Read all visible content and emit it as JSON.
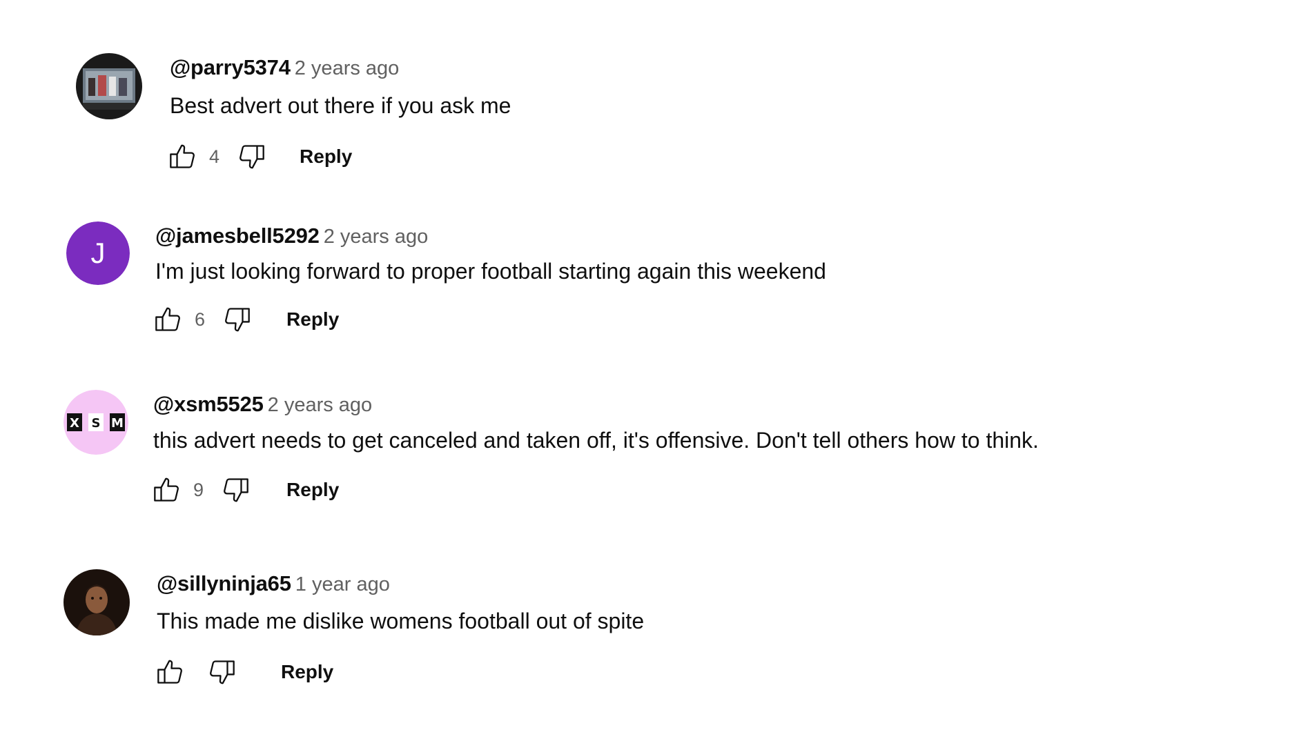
{
  "comments": [
    {
      "author": "@parry5374",
      "time": "2 years ago",
      "text": "Best advert out there if you ask me",
      "likes": "4",
      "reply_label": "Reply",
      "avatar": {
        "type": "photo",
        "description_icon": "shop-window-photo"
      }
    },
    {
      "author": "@jamesbell5292",
      "time": "2 years ago",
      "text": "I'm just looking forward to proper football starting again this weekend",
      "likes": "6",
      "reply_label": "Reply",
      "avatar": {
        "type": "letter",
        "letter": "J",
        "color": "#7b2cbf"
      }
    },
    {
      "author": "@xsm5525",
      "time": "2 years ago",
      "text": "this advert needs to get canceled and taken off, it's offensive. Don't tell others how to think.",
      "likes": "9",
      "reply_label": "Reply",
      "avatar": {
        "type": "logo",
        "letters": [
          "X",
          "S",
          "M"
        ],
        "color": "#f5c6f5"
      }
    },
    {
      "author": "@sillyninja65",
      "time": "1 year ago",
      "text": "This made me dislike womens football out of spite",
      "likes": "",
      "reply_label": "Reply",
      "avatar": {
        "type": "photo",
        "description_icon": "portrait-photo"
      }
    }
  ],
  "icons": {
    "like": "thumbs-up-icon",
    "dislike": "thumbs-down-icon"
  },
  "colors": {
    "text_primary": "#0f0f0f",
    "text_secondary": "#606060",
    "avatar_purple": "#7b2cbf",
    "avatar_pink": "#f5c6f5"
  }
}
